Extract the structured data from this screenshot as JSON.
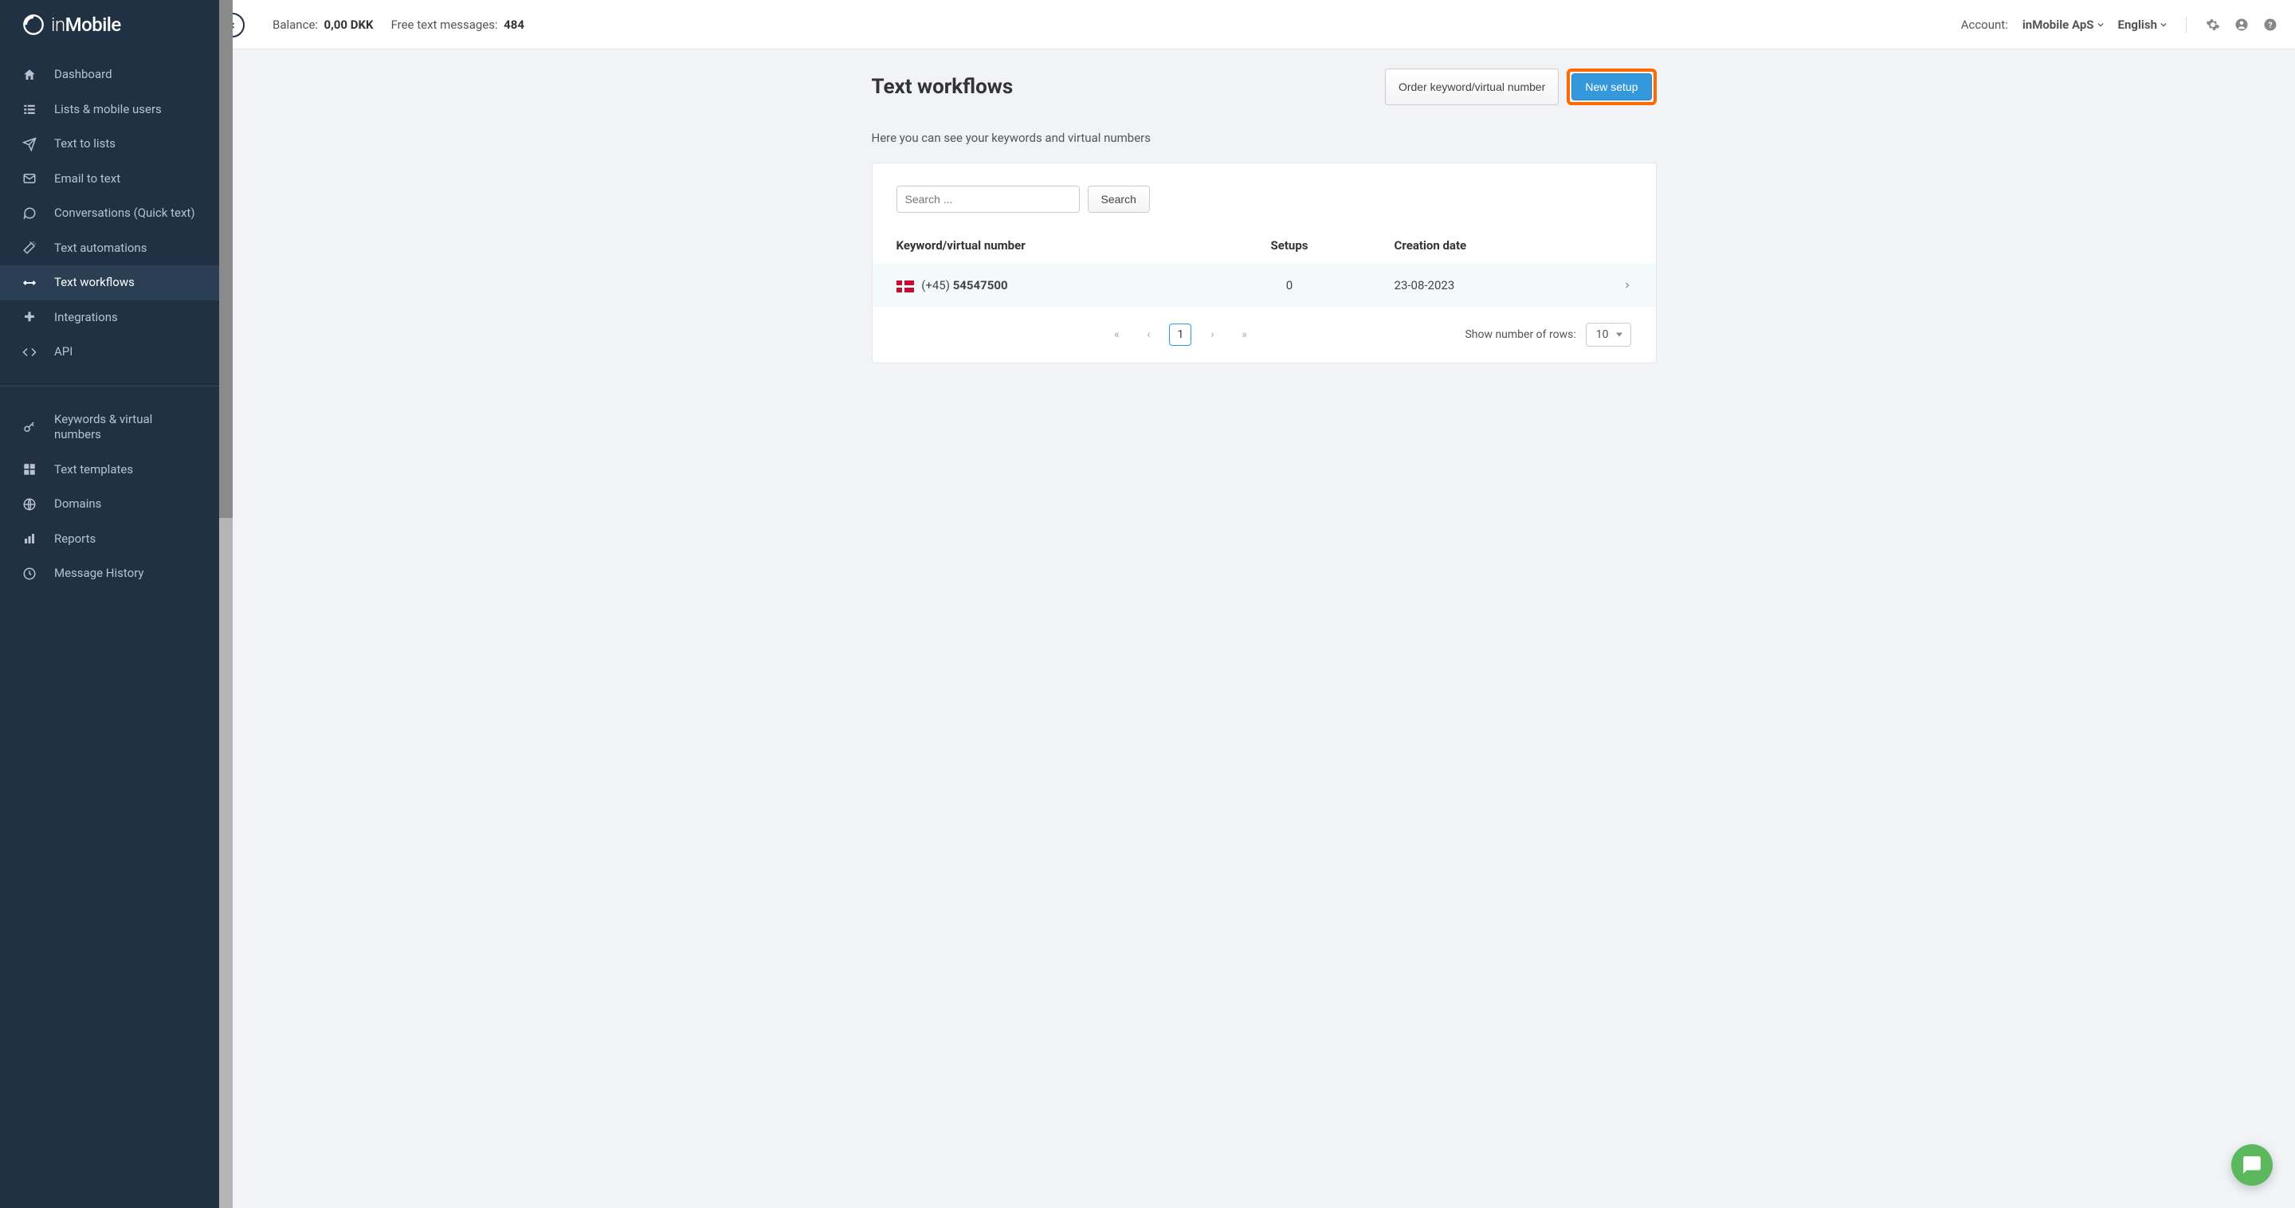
{
  "brand": {
    "name_thin": "in",
    "name_bold": "Mobile"
  },
  "sidebar": {
    "items": [
      {
        "label": "Dashboard"
      },
      {
        "label": "Lists & mobile users"
      },
      {
        "label": "Text to lists"
      },
      {
        "label": "Email to text"
      },
      {
        "label": "Conversations (Quick text)"
      },
      {
        "label": "Text automations"
      },
      {
        "label": "Text workflows"
      },
      {
        "label": "Integrations"
      },
      {
        "label": "API"
      }
    ],
    "items2": [
      {
        "label": "Keywords & virtual numbers"
      },
      {
        "label": "Text templates"
      },
      {
        "label": "Domains"
      },
      {
        "label": "Reports"
      },
      {
        "label": "Message History"
      }
    ]
  },
  "topbar": {
    "balance_label": "Balance:",
    "balance_value": "0,00 DKK",
    "free_label": "Free text messages:",
    "free_value": "484",
    "account_label": "Account:",
    "account_value": "inMobile ApS",
    "language": "English"
  },
  "page": {
    "title": "Text workflows",
    "order_btn": "Order keyword/virtual number",
    "new_btn": "New setup",
    "subtitle": "Here you can see your keywords and virtual numbers"
  },
  "searchbox": {
    "placeholder": "Search ...",
    "button": "Search"
  },
  "table": {
    "headers": {
      "keyword": "Keyword/virtual number",
      "setups": "Setups",
      "creation": "Creation date"
    },
    "rows": [
      {
        "prefix": "(+45)",
        "number": "54547500",
        "setups": "0",
        "creation": "23-08-2023"
      }
    ]
  },
  "pager": {
    "current": "1",
    "rows_label": "Show number of rows:",
    "rows_value": "10"
  }
}
